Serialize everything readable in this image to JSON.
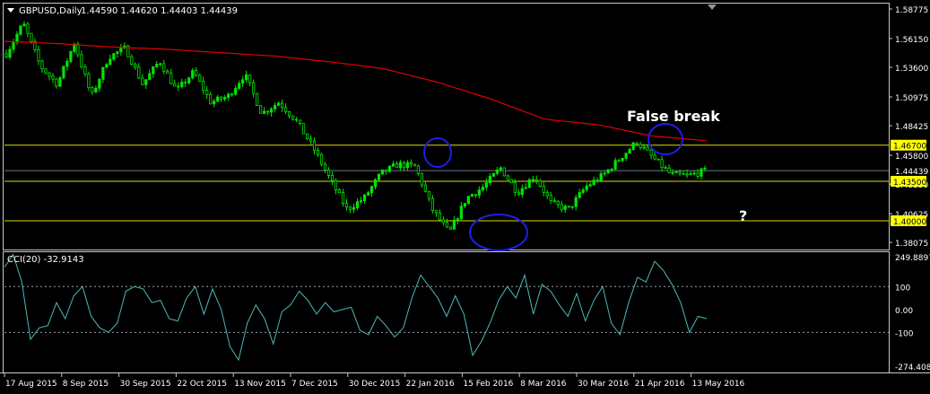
{
  "window": {
    "symbol_header": "GBPUSD,Daily",
    "ohlc_header": "1.44590 1.44620 1.44403 1.44439",
    "indicator_header": "CCI(20) -32.9143",
    "menu_icon": "triangle-down-icon",
    "scroll_marker_icon": "triangle-down-icon"
  },
  "annotations": {
    "false_break": "False break",
    "question": "?"
  },
  "colors": {
    "background": "#000000",
    "border": "#c8c8c8",
    "candle": "#00e600",
    "ma": "#e00000",
    "level_line": "#d8d800",
    "current_line": "#6a7a8a",
    "cci": "#4fb8b8",
    "circle": "#1e1ee6",
    "label_bg": "#ffff00"
  },
  "chart_data": [
    {
      "type": "candlestick",
      "ylim": [
        1.3745,
        1.5925
      ],
      "y_ticks": [
        "1.58775",
        "1.56150",
        "1.53600",
        "1.50975",
        "1.48425",
        "1.45800",
        "1.43250",
        "1.40625",
        "1.38075"
      ],
      "x_ticks": [
        "17 Aug 2015",
        "8 Sep 2015",
        "30 Sep 2015",
        "22 Oct 2015",
        "13 Nov 2015",
        "7 Dec 2015",
        "30 Dec 2015",
        "22 Jan 2016",
        "15 Feb 2016",
        "8 Mar 2016",
        "30 Mar 2016",
        "21 Apr 2016",
        "13 May 2016"
      ],
      "levels": [
        {
          "value": 1.467,
          "label": "1.46700"
        },
        {
          "value": 1.435,
          "label": "1.43500"
        },
        {
          "value": 1.4,
          "label": "1.40000"
        }
      ],
      "current": {
        "value": 1.44439,
        "label": "1.44439"
      },
      "close_anchors": [
        1.548,
        1.575,
        1.537,
        1.521,
        1.558,
        1.51,
        1.545,
        1.553,
        1.521,
        1.542,
        1.515,
        1.532,
        1.505,
        1.51,
        1.53,
        1.495,
        1.505,
        1.489,
        1.465,
        1.437,
        1.41,
        1.42,
        1.442,
        1.45,
        1.448,
        1.41,
        1.389,
        1.42,
        1.43,
        1.447,
        1.425,
        1.44,
        1.415,
        1.41,
        1.43,
        1.44,
        1.455,
        1.47,
        1.455,
        1.441,
        1.44,
        1.444
      ],
      "moving_average_anchors": [
        1.559,
        1.557,
        1.554,
        1.552,
        1.549,
        1.546,
        1.541,
        1.535,
        1.523,
        1.508,
        1.49,
        1.485,
        1.475,
        1.471
      ],
      "extent_x": [
        "17 Aug 2015",
        "18 May 2016"
      ]
    },
    {
      "type": "line",
      "name": "CCI(20)",
      "ylim": [
        -274.4083,
        249.8897
      ],
      "y_ticks": [
        "249.8897",
        "100",
        "0.00",
        "-100",
        "-274.4083"
      ],
      "levels": [
        100,
        -100
      ],
      "values": [
        185,
        240,
        120,
        -130,
        -80,
        -70,
        30,
        -40,
        60,
        100,
        -30,
        -80,
        -100,
        -60,
        80,
        100,
        90,
        30,
        40,
        -40,
        -50,
        50,
        100,
        -20,
        90,
        0,
        -160,
        -220,
        -60,
        20,
        -40,
        -150,
        -10,
        20,
        80,
        40,
        -20,
        30,
        -10,
        0,
        10,
        -90,
        -110,
        -30,
        -70,
        -120,
        -80,
        50,
        150,
        100,
        50,
        -30,
        60,
        -20,
        -200,
        -140,
        -60,
        40,
        100,
        50,
        150,
        -20,
        110,
        80,
        20,
        -30,
        70,
        -50,
        40,
        100,
        -60,
        -110,
        30,
        140,
        120,
        210,
        170,
        110,
        30,
        -100,
        -30,
        -40
      ]
    }
  ]
}
